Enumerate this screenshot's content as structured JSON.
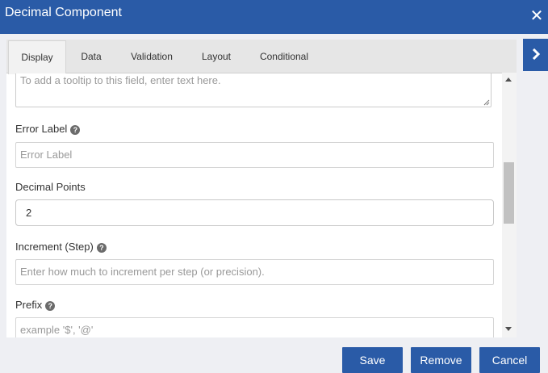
{
  "dialog": {
    "title": "Decimal Component",
    "close_glyph": "✕",
    "close_icon": "close-icon",
    "side_toggle_icon": "chevron-right-icon"
  },
  "tabs": [
    {
      "label": "Display",
      "active": true
    },
    {
      "label": "Data",
      "active": false
    },
    {
      "label": "Validation",
      "active": false
    },
    {
      "label": "Layout",
      "active": false
    },
    {
      "label": "Conditional",
      "active": false
    }
  ],
  "form": {
    "tooltip": {
      "placeholder": "To add a tooltip to this field, enter text here."
    },
    "error_label": {
      "label": "Error Label",
      "placeholder": "Error Label",
      "help": "?"
    },
    "decimal_points": {
      "label": "Decimal Points",
      "value": "2"
    },
    "increment": {
      "label": "Increment (Step)",
      "placeholder": "Enter how much to increment per step (or precision).",
      "help": "?"
    },
    "prefix": {
      "label": "Prefix",
      "placeholder": "example '$', '@'",
      "help": "?"
    }
  },
  "buttons": {
    "save": "Save",
    "remove": "Remove",
    "cancel": "Cancel"
  },
  "colors": {
    "accent": "#2a5ba7",
    "background": "#eeeff3"
  }
}
